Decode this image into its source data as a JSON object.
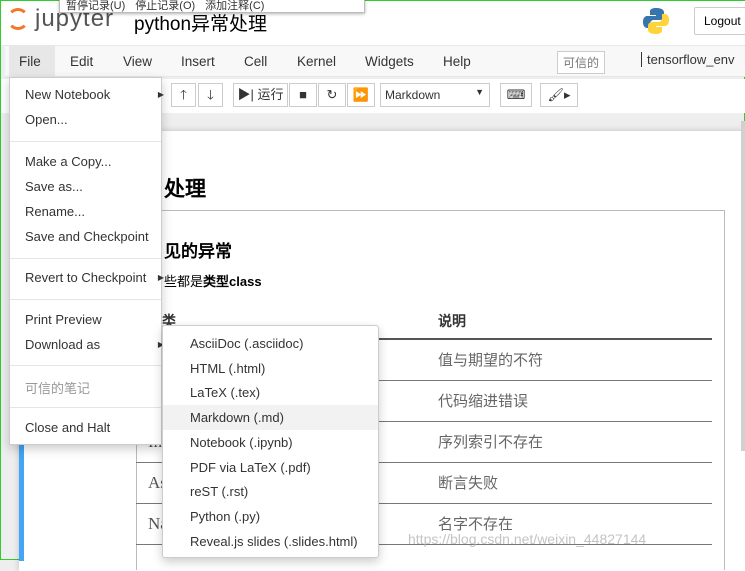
{
  "header": {
    "logo_text": "jupyter",
    "title": "python异常处理",
    "logout": "Logout"
  },
  "recorder": {
    "items": [
      "暂停记录(U)",
      "停止记录(O)",
      "添加注释(C)"
    ]
  },
  "menubar": {
    "items": [
      "File",
      "Edit",
      "View",
      "Insert",
      "Cell",
      "Kernel",
      "Widgets",
      "Help"
    ],
    "trusted": "可信的",
    "kernel": "tensorflow_env"
  },
  "toolbar": {
    "run": "运行",
    "cell_type": "Markdown"
  },
  "content": {
    "h1": "处理",
    "h2": "见的异常",
    "para_prefix": "些都是",
    "para_bold": "类型class",
    "table": {
      "headers": [
        "常类",
        "说明"
      ],
      "rows": [
        [
          "",
          "值与期望的不符"
        ],
        [
          "",
          "代码缩进错误"
        ],
        [
          "Ind",
          "序列索引不存在"
        ],
        [
          "Ass",
          "断言失败"
        ],
        [
          "Nam",
          "名字不存在"
        ]
      ]
    }
  },
  "file_menu": {
    "items": [
      "New Notebook",
      "Open...",
      "Make a Copy...",
      "Save as...",
      "Rename...",
      "Save and Checkpoint",
      "Revert to Checkpoint",
      "Print Preview",
      "Download as",
      "可信的笔记",
      "Close and Halt"
    ]
  },
  "download_menu": {
    "items": [
      "AsciiDoc (.asciidoc)",
      "HTML (.html)",
      "LaTeX (.tex)",
      "Markdown (.md)",
      "Notebook (.ipynb)",
      "PDF via LaTeX (.pdf)",
      "reST (.rst)",
      "Python (.py)",
      "Reveal.js slides (.slides.html)"
    ],
    "highlighted": "Markdown (.md)"
  },
  "watermark": "https://blog.csdn.net/weixin_44827144",
  "colors": {
    "accent": "#f37726",
    "selected_cell": "#42a5f5"
  }
}
